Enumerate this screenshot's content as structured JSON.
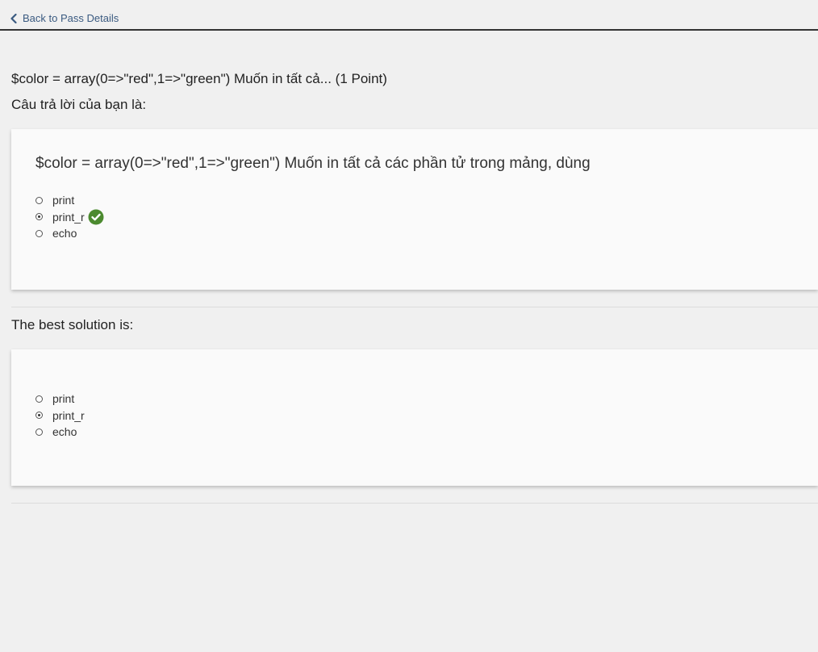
{
  "nav": {
    "back_label": "Back to Pass Details"
  },
  "question": {
    "title": "$color = array(0=>\"red\",1=>\"green\") Muốn in tất cả... (1 Point)",
    "answer_label": "Câu trả lời của bạn là:",
    "full_text": "$color = array(0=>\"red\",1=>\"green\") Muốn in tất cả các phần tử trong mảng, dùng"
  },
  "your_answer": {
    "options": [
      {
        "label": "print",
        "selected": false
      },
      {
        "label": "print_r",
        "selected": true,
        "correct": true
      },
      {
        "label": "echo",
        "selected": false
      }
    ]
  },
  "best_solution": {
    "label": "The best solution is:",
    "options": [
      {
        "label": "print",
        "selected": false
      },
      {
        "label": "print_r",
        "selected": true
      },
      {
        "label": "echo",
        "selected": false
      }
    ]
  },
  "colors": {
    "background": "#f0f0f0",
    "card": "#fafafa",
    "link": "#3a5a80",
    "correct_badge": "#4c8a2f"
  },
  "icons": {
    "back": "chevron-left-icon",
    "correct": "checkmark-circle-icon"
  }
}
